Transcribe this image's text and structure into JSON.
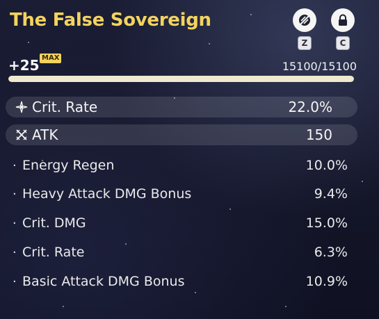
{
  "weapon": {
    "name": "The False Sovereign",
    "level": "+25",
    "max_badge": "MAX",
    "exp_text": "15100/15100",
    "exp_progress": 1.0
  },
  "controls": {
    "lock_hint_key": "Z",
    "lock_key": "C",
    "lock_hint_icon": "no-lock-icon",
    "lock_icon": "padlock-icon"
  },
  "main_stats": [
    {
      "label": "Crit. Rate",
      "value": "22.0%",
      "icon": "crit-rate-icon"
    },
    {
      "label": "ATK",
      "value": "150",
      "icon": "atk-swords-icon"
    }
  ],
  "sub_stats": [
    {
      "label": "Energy Regen",
      "value": "10.0%"
    },
    {
      "label": "Heavy Attack DMG Bonus",
      "value": "9.4%"
    },
    {
      "label": "Crit. DMG",
      "value": "15.0%"
    },
    {
      "label": "Crit. Rate",
      "value": "6.3%"
    },
    {
      "label": "Basic Attack DMG Bonus",
      "value": "10.9%"
    }
  ],
  "colors": {
    "title": "#f4d35e",
    "badge": "#f4d35e",
    "exp_fill": "#efe9cf"
  }
}
